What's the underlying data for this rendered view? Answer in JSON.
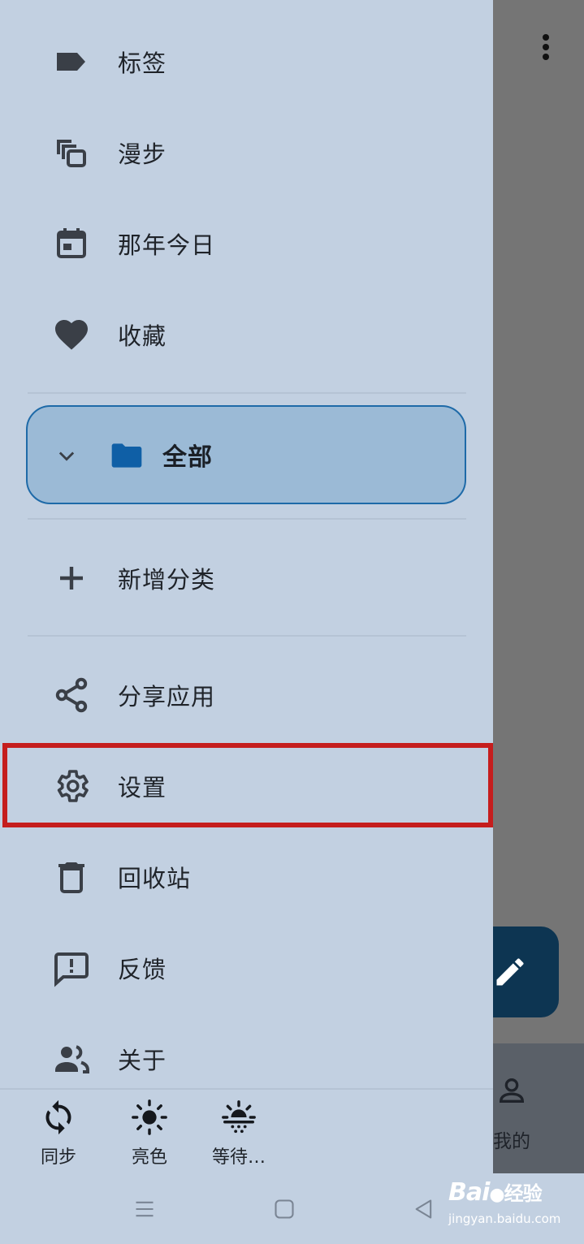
{
  "drawer": {
    "top_items": [
      {
        "label": "标签",
        "icon": "label-icon"
      },
      {
        "label": "漫步",
        "icon": "stack-copy-icon"
      },
      {
        "label": "那年今日",
        "icon": "calendar-icon"
      },
      {
        "label": "收藏",
        "icon": "heart-icon"
      }
    ],
    "folder": {
      "label": "全部",
      "icon": "folder-icon",
      "expanded": true
    },
    "add_category": {
      "label": "新增分类"
    },
    "bottom_items": [
      {
        "label": "分享应用",
        "icon": "share-icon"
      },
      {
        "label": "设置",
        "icon": "gear-icon",
        "highlighted": true
      },
      {
        "label": "回收站",
        "icon": "trash-icon"
      },
      {
        "label": "反馈",
        "icon": "feedback-icon"
      },
      {
        "label": "关于",
        "icon": "people-icon"
      }
    ],
    "quick_actions": [
      {
        "label": "同步",
        "icon": "sync-icon"
      },
      {
        "label": "亮色",
        "icon": "sun-icon"
      },
      {
        "label": "等待…",
        "icon": "sun-dim-icon"
      }
    ]
  },
  "background": {
    "nav_label": "我的"
  },
  "watermark": {
    "brand": "Bai",
    "brand_suffix": "经验",
    "url": "jingyan.baidu.com"
  },
  "colors": {
    "drawer_bg": "#c2d0e1",
    "folder_fill": "#9bbad6",
    "folder_border": "#1e6aa8",
    "folder_icon": "#0f5fa6",
    "highlight_border": "#c51d1d",
    "fab": "#0d3552"
  }
}
